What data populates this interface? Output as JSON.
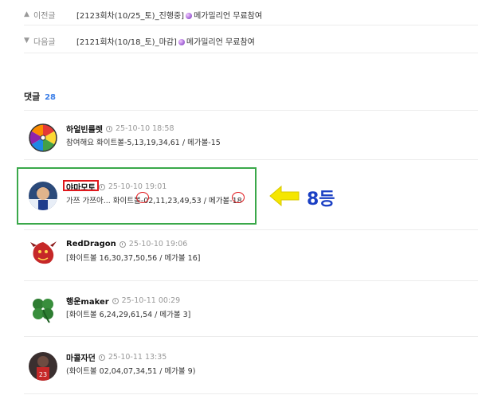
{
  "nav": {
    "prev": {
      "label": "이전글",
      "title": "[2123회차(10/25_토)_진행중]",
      "suffix": "메가밀리언 무료참여"
    },
    "next": {
      "label": "다음글",
      "title": "[2121회차(10/18_토)_마감]",
      "suffix": "메가밀리언 무료참여"
    }
  },
  "comments_header": {
    "label": "댓글",
    "count": "28"
  },
  "comments": [
    {
      "author": "하얼빈룰렛",
      "date": "25-10-10 18:58",
      "text": "참여해요 화이트볼-5,13,19,34,61 / 메가볼-15",
      "avatar": "roulette-wheel"
    },
    {
      "author": "야마모토",
      "date": "25-10-10 19:01",
      "text_parts": [
        "가쯔 가쯔아... 화이트볼-",
        "02",
        ",11,23,49,53 / 메가볼-",
        "18"
      ],
      "avatar": "baseball-player"
    },
    {
      "author": "RedDragon",
      "date": "25-10-10 19:06",
      "text": "[화이트볼 16,30,37,50,56 / 메가볼 16]",
      "avatar": "red-dragon"
    },
    {
      "author": "행운maker",
      "date": "25-10-11 00:29",
      "text": "[화이트볼 6,24,29,61,54 / 메가볼 3]",
      "avatar": "four-leaf-clover"
    },
    {
      "author": "마콜자던",
      "date": "25-10-11 13:35",
      "text": "(화이트볼 02,04,07,34,51 / 메가볼 9)",
      "avatar": "basketball-player"
    }
  ],
  "annotation": {
    "rank": "8등",
    "arrow_color": "#f5e600",
    "box_color": "#3aa84a",
    "mark_color": "#e0181c"
  },
  "colors": {
    "count": "#3b7ee8",
    "rank_text": "#1a3fc4"
  }
}
